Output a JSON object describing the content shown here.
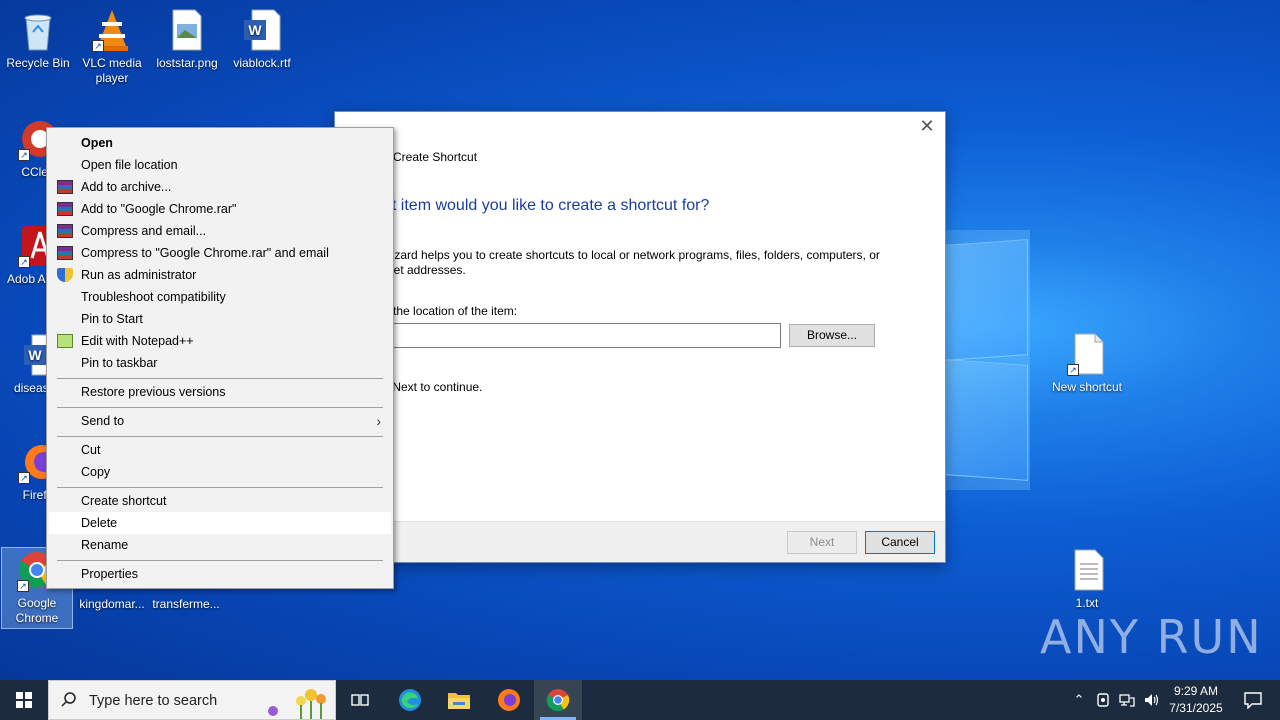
{
  "desktop": {
    "icons": [
      {
        "label": "Recycle Bin",
        "icon": "recycle-bin-icon"
      },
      {
        "label": "VLC media player",
        "icon": "vlc-icon"
      },
      {
        "label": "loststar.png",
        "icon": "image-file-icon"
      },
      {
        "label": "viablock.rtf",
        "icon": "word-document-icon"
      },
      {
        "label": "CClea",
        "icon": "ccleaner-icon"
      },
      {
        "label": "Adob Acrob",
        "icon": "acrobat-icon"
      },
      {
        "label": "diseaseb",
        "icon": "word-document-icon"
      },
      {
        "label": "Firefo",
        "icon": "firefox-icon"
      },
      {
        "label": "Google Chrome",
        "icon": "chrome-icon"
      },
      {
        "label": "kingdomar...",
        "icon": "file-icon"
      },
      {
        "label": "transferme...",
        "icon": "file-icon"
      },
      {
        "label": "New shortcut",
        "icon": "blank-file-icon"
      },
      {
        "label": "1.txt",
        "icon": "text-file-icon"
      }
    ],
    "watermark": "ANY RUN"
  },
  "wizard": {
    "title": "Create Shortcut",
    "heading": "at item would you like to create a shortcut for?",
    "description": "wizard helps you to create shortcuts to local or network programs, files, folders, computers, or rnet addresses.",
    "location_label": "e the location of the item:",
    "location_value": "",
    "browse_label": "Browse...",
    "hint": "k Next to continue.",
    "next_label": "Next",
    "cancel_label": "Cancel"
  },
  "context_menu": {
    "items": [
      {
        "label": "Open",
        "bold": true
      },
      {
        "label": "Open file location"
      },
      {
        "label": "Add to archive...",
        "icon": "winrar-icon"
      },
      {
        "label": "Add to \"Google Chrome.rar\"",
        "icon": "winrar-icon"
      },
      {
        "label": "Compress and email...",
        "icon": "winrar-icon"
      },
      {
        "label": "Compress to \"Google Chrome.rar\" and email",
        "icon": "winrar-icon"
      },
      {
        "label": "Run as administrator",
        "icon": "uac-shield-icon"
      },
      {
        "label": "Troubleshoot compatibility"
      },
      {
        "label": "Pin to Start"
      },
      {
        "label": "Edit with Notepad++",
        "icon": "notepadpp-icon"
      },
      {
        "label": "Pin to taskbar"
      },
      {
        "label": "Restore previous versions"
      },
      {
        "label": "Send to"
      },
      {
        "label": "Cut"
      },
      {
        "label": "Copy"
      },
      {
        "label": "Create shortcut"
      },
      {
        "label": "Delete"
      },
      {
        "label": "Rename"
      },
      {
        "label": "Properties"
      }
    ]
  },
  "taskbar": {
    "search_placeholder": "Type here to search",
    "time": "9:29 AM",
    "date": "7/31/2025"
  }
}
